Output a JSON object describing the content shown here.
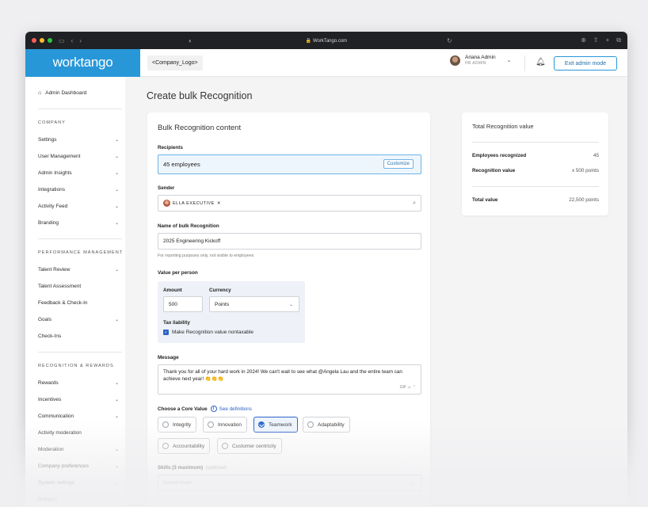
{
  "browser": {
    "url": "WorkTango.com",
    "traffic_colors": [
      "#ff5f57",
      "#febc2e",
      "#28c840"
    ]
  },
  "header": {
    "brand": "worktango",
    "company_logo": "<Company_Logo>",
    "user_name": "Ariana Admin",
    "user_role": "HR ADMIN",
    "exit_button": "Exit admin mode",
    "accent_color": "#2897d8"
  },
  "sidebar": {
    "dashboard": "Admin Dashboard",
    "sections": [
      {
        "heading": "COMPANY",
        "items": [
          "Settings",
          "User Management",
          "Admin Insights",
          "Integrations",
          "Activity Feed",
          "Branding"
        ]
      },
      {
        "heading": "PERFORMANCE MANAGEMENT",
        "items": [
          "Talent Review",
          "Talent Assessment",
          "Feedback & Check-In",
          "Goals",
          "Check-Ins"
        ]
      },
      {
        "heading": "RECOGNITION & REWARDS",
        "items": [
          "Rewards",
          "Incentives",
          "Communication",
          "Activity moderation",
          "Moderation",
          "Company preferences",
          "System settings",
          "Budgets"
        ]
      }
    ]
  },
  "main": {
    "page_title": "Create bulk Recognition",
    "form": {
      "title": "Bulk Recognition content",
      "recipients_label": "Recipients",
      "recipients_value": "45 employees",
      "customize_button": "Customize",
      "sender_label": "Sender",
      "sender_chip": "ELLA EXECUTIVE",
      "name_label": "Name of bulk Recognition",
      "name_value": "2025 Engineering Kickoff",
      "name_hint": "For reporting purposes only, not visible to employees",
      "value_label": "Value per person",
      "amount_label": "Amount",
      "amount_value": "500",
      "currency_label": "Currency",
      "currency_value": "Points",
      "tax_label": "Tax liability",
      "tax_checkbox": "Make Recognition value nontaxable",
      "tax_checked": true,
      "message_label": "Message",
      "message_text": "Thank you for all of your hard work in 2024! We can't wait to see what @Angela Lau and the entire team can achieve next year! 👏👏👏",
      "message_tool_gif": "GIF",
      "core_value_label": "Choose a Core Value",
      "definitions_link": "See definitions",
      "core_values": [
        "Integrity",
        "Innovation",
        "Teamwork",
        "Adaptability",
        "Accountability",
        "Customer centricity"
      ],
      "selected_core_value": "Teamwork",
      "skills_label": "Skills (3 maximum)",
      "skills_optional": "(optional)",
      "skills_value": "Dream team"
    },
    "summary": {
      "title": "Total Recognition value",
      "employees_label": "Employees recognized",
      "employees_value": "45",
      "recognition_label": "Recognition value",
      "recognition_value": "x 500 points",
      "total_label": "Total value",
      "total_value": "22,500 points"
    }
  }
}
